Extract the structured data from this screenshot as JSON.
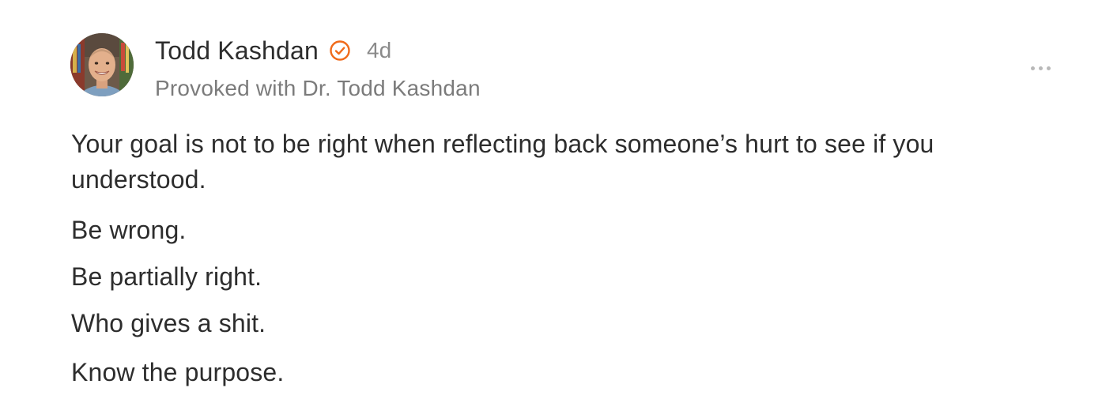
{
  "post": {
    "author": {
      "name": "Todd Kashdan",
      "avatar_icon": "avatar-photo",
      "verified_icon": "verified-check-icon",
      "verified_color": "#F06A1A"
    },
    "timestamp": "4d",
    "publication": "Provoked with Dr. Todd Kashdan",
    "more_icon": "ellipsis-icon",
    "paragraphs": [
      "Your goal is not to be right when reflecting back someone’s hurt to see if you understood.",
      "Be wrong.",
      "Be partially right.",
      "Who gives a shit.",
      "Know the purpose."
    ]
  }
}
